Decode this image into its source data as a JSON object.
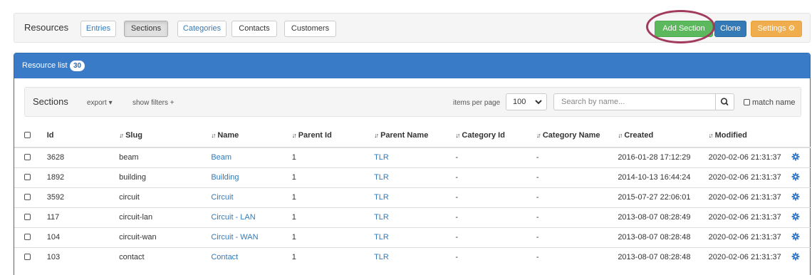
{
  "toolbar": {
    "title": "Resources",
    "tabs": [
      "Entries",
      "Sections",
      "Categories",
      "Contacts",
      "Customers"
    ],
    "active_tab": "Sections",
    "add_label": "Add Section",
    "clone_label": "Clone",
    "settings_label": "Settings",
    "colors": {
      "green": "#5cb85c",
      "blue": "#337ab7",
      "orange": "#f0ad4e",
      "panel": "#3a7bc8",
      "highlight": "#a23a5e"
    }
  },
  "panel": {
    "title": "Resource list",
    "count": "30"
  },
  "filters": {
    "title": "Sections",
    "export_label": "export ▾",
    "show_filters_label": "show filters +",
    "items_per_page_label": "items per page",
    "items_per_page_value": "100",
    "search_placeholder": "Search by name...",
    "match_name_label": "match name"
  },
  "table": {
    "columns": [
      "Id",
      "Slug",
      "Name",
      "Parent Id",
      "Parent Name",
      "Category Id",
      "Category Name",
      "Created",
      "Modified"
    ],
    "rows": [
      {
        "id": "3628",
        "slug": "beam",
        "name": "Beam",
        "parent_id": "1",
        "parent_name": "TLR",
        "category_id": "-",
        "category_name": "-",
        "created": "2016-01-28 17:12:29",
        "modified": "2020-02-06 21:31:37"
      },
      {
        "id": "1892",
        "slug": "building",
        "name": "Building",
        "parent_id": "1",
        "parent_name": "TLR",
        "category_id": "-",
        "category_name": "-",
        "created": "2014-10-13 16:44:24",
        "modified": "2020-02-06 21:31:37"
      },
      {
        "id": "3592",
        "slug": "circuit",
        "name": "Circuit",
        "parent_id": "1",
        "parent_name": "TLR",
        "category_id": "-",
        "category_name": "-",
        "created": "2015-07-27 22:06:01",
        "modified": "2020-02-06 21:31:37"
      },
      {
        "id": "117",
        "slug": "circuit-lan",
        "name": "Circuit - LAN",
        "parent_id": "1",
        "parent_name": "TLR",
        "category_id": "-",
        "category_name": "-",
        "created": "2013-08-07 08:28:49",
        "modified": "2020-02-06 21:31:37"
      },
      {
        "id": "104",
        "slug": "circuit-wan",
        "name": "Circuit - WAN",
        "parent_id": "1",
        "parent_name": "TLR",
        "category_id": "-",
        "category_name": "-",
        "created": "2013-08-07 08:28:48",
        "modified": "2020-02-06 21:31:37"
      },
      {
        "id": "103",
        "slug": "contact",
        "name": "Contact",
        "parent_id": "1",
        "parent_name": "TLR",
        "category_id": "-",
        "category_name": "-",
        "created": "2013-08-07 08:28:48",
        "modified": "2020-02-06 21:31:37"
      }
    ]
  }
}
